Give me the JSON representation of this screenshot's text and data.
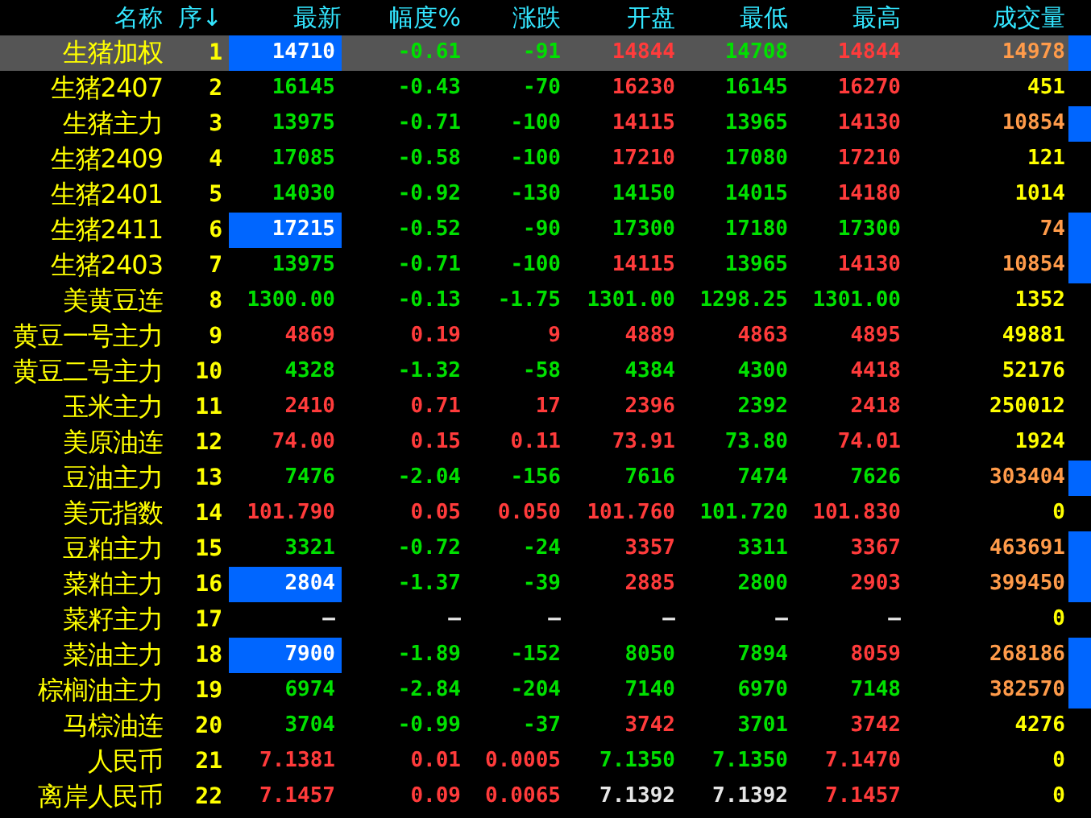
{
  "header": {
    "columns": [
      "名称",
      "序",
      "最新",
      "幅度%",
      "涨跌",
      "开盘",
      "最低",
      "最高",
      "成交量"
    ],
    "sort_arrow": "↓"
  },
  "rows": [
    {
      "name": "生猪加权",
      "index": "1",
      "selected": true,
      "latest_highlighted": true,
      "volume_marked": true,
      "cells": [
        {
          "text": "14710"
        },
        {
          "text": "-0.61",
          "kind": "fall"
        },
        {
          "text": "-91",
          "kind": "fall"
        },
        {
          "text": "14844",
          "kind": "rise"
        },
        {
          "text": "14708",
          "kind": "fall"
        },
        {
          "text": "14844",
          "kind": "rise"
        },
        {
          "text": "14978",
          "kind": "active"
        }
      ]
    },
    {
      "name": "生猪2407",
      "index": "2",
      "selected": false,
      "latest_highlighted": false,
      "volume_marked": false,
      "cells": [
        {
          "text": "16145",
          "kind": "fall"
        },
        {
          "text": "-0.43",
          "kind": "fall"
        },
        {
          "text": "-70",
          "kind": "fall"
        },
        {
          "text": "16230",
          "kind": "rise"
        },
        {
          "text": "16145",
          "kind": "fall"
        },
        {
          "text": "16270",
          "kind": "rise"
        },
        {
          "text": "451",
          "kind": "plain"
        }
      ]
    },
    {
      "name": "生猪主力",
      "index": "3",
      "selected": false,
      "latest_highlighted": false,
      "volume_marked": true,
      "cells": [
        {
          "text": "13975",
          "kind": "fall"
        },
        {
          "text": "-0.71",
          "kind": "fall"
        },
        {
          "text": "-100",
          "kind": "fall"
        },
        {
          "text": "14115",
          "kind": "rise"
        },
        {
          "text": "13965",
          "kind": "fall"
        },
        {
          "text": "14130",
          "kind": "rise"
        },
        {
          "text": "10854",
          "kind": "active"
        }
      ]
    },
    {
      "name": "生猪2409",
      "index": "4",
      "selected": false,
      "latest_highlighted": false,
      "volume_marked": false,
      "cells": [
        {
          "text": "17085",
          "kind": "fall"
        },
        {
          "text": "-0.58",
          "kind": "fall"
        },
        {
          "text": "-100",
          "kind": "fall"
        },
        {
          "text": "17210",
          "kind": "rise"
        },
        {
          "text": "17080",
          "kind": "fall"
        },
        {
          "text": "17210",
          "kind": "rise"
        },
        {
          "text": "121",
          "kind": "plain"
        }
      ]
    },
    {
      "name": "生猪2401",
      "index": "5",
      "selected": false,
      "latest_highlighted": false,
      "volume_marked": false,
      "cells": [
        {
          "text": "14030",
          "kind": "fall"
        },
        {
          "text": "-0.92",
          "kind": "fall"
        },
        {
          "text": "-130",
          "kind": "fall"
        },
        {
          "text": "14150",
          "kind": "fall"
        },
        {
          "text": "14015",
          "kind": "fall"
        },
        {
          "text": "14180",
          "kind": "rise"
        },
        {
          "text": "1014",
          "kind": "plain"
        }
      ]
    },
    {
      "name": "生猪2411",
      "index": "6",
      "selected": false,
      "latest_highlighted": true,
      "volume_marked": true,
      "cells": [
        {
          "text": "17215"
        },
        {
          "text": "-0.52",
          "kind": "fall"
        },
        {
          "text": "-90",
          "kind": "fall"
        },
        {
          "text": "17300",
          "kind": "fall"
        },
        {
          "text": "17180",
          "kind": "fall"
        },
        {
          "text": "17300",
          "kind": "fall"
        },
        {
          "text": "74",
          "kind": "active"
        }
      ]
    },
    {
      "name": "生猪2403",
      "index": "7",
      "selected": false,
      "latest_highlighted": false,
      "volume_marked": true,
      "cells": [
        {
          "text": "13975",
          "kind": "fall"
        },
        {
          "text": "-0.71",
          "kind": "fall"
        },
        {
          "text": "-100",
          "kind": "fall"
        },
        {
          "text": "14115",
          "kind": "rise"
        },
        {
          "text": "13965",
          "kind": "fall"
        },
        {
          "text": "14130",
          "kind": "rise"
        },
        {
          "text": "10854",
          "kind": "active"
        }
      ]
    },
    {
      "name": "美黄豆连",
      "index": "8",
      "selected": false,
      "latest_highlighted": false,
      "volume_marked": false,
      "cells": [
        {
          "text": "1300.00",
          "kind": "fall"
        },
        {
          "text": "-0.13",
          "kind": "fall"
        },
        {
          "text": "-1.75",
          "kind": "fall"
        },
        {
          "text": "1301.00",
          "kind": "fall"
        },
        {
          "text": "1298.25",
          "kind": "fall"
        },
        {
          "text": "1301.00",
          "kind": "fall"
        },
        {
          "text": "1352",
          "kind": "plain"
        }
      ]
    },
    {
      "name": "黄豆一号主力",
      "index": "9",
      "selected": false,
      "latest_highlighted": false,
      "volume_marked": false,
      "cells": [
        {
          "text": "4869",
          "kind": "rise"
        },
        {
          "text": "0.19",
          "kind": "rise"
        },
        {
          "text": "9",
          "kind": "rise"
        },
        {
          "text": "4889",
          "kind": "rise"
        },
        {
          "text": "4863",
          "kind": "rise"
        },
        {
          "text": "4895",
          "kind": "rise"
        },
        {
          "text": "49881",
          "kind": "plain"
        }
      ]
    },
    {
      "name": "黄豆二号主力",
      "index": "10",
      "selected": false,
      "latest_highlighted": false,
      "volume_marked": false,
      "cells": [
        {
          "text": "4328",
          "kind": "fall"
        },
        {
          "text": "-1.32",
          "kind": "fall"
        },
        {
          "text": "-58",
          "kind": "fall"
        },
        {
          "text": "4384",
          "kind": "fall"
        },
        {
          "text": "4300",
          "kind": "fall"
        },
        {
          "text": "4418",
          "kind": "rise"
        },
        {
          "text": "52176",
          "kind": "plain"
        }
      ]
    },
    {
      "name": "玉米主力",
      "index": "11",
      "selected": false,
      "latest_highlighted": false,
      "volume_marked": false,
      "cells": [
        {
          "text": "2410",
          "kind": "rise"
        },
        {
          "text": "0.71",
          "kind": "rise"
        },
        {
          "text": "17",
          "kind": "rise"
        },
        {
          "text": "2396",
          "kind": "rise"
        },
        {
          "text": "2392",
          "kind": "fall"
        },
        {
          "text": "2418",
          "kind": "rise"
        },
        {
          "text": "250012",
          "kind": "plain"
        }
      ]
    },
    {
      "name": "美原油连",
      "index": "12",
      "selected": false,
      "latest_highlighted": false,
      "volume_marked": false,
      "cells": [
        {
          "text": "74.00",
          "kind": "rise"
        },
        {
          "text": "0.15",
          "kind": "rise"
        },
        {
          "text": "0.11",
          "kind": "rise"
        },
        {
          "text": "73.91",
          "kind": "rise"
        },
        {
          "text": "73.80",
          "kind": "fall"
        },
        {
          "text": "74.01",
          "kind": "rise"
        },
        {
          "text": "1924",
          "kind": "plain"
        }
      ]
    },
    {
      "name": "豆油主力",
      "index": "13",
      "selected": false,
      "latest_highlighted": false,
      "volume_marked": true,
      "cells": [
        {
          "text": "7476",
          "kind": "fall"
        },
        {
          "text": "-2.04",
          "kind": "fall"
        },
        {
          "text": "-156",
          "kind": "fall"
        },
        {
          "text": "7616",
          "kind": "fall"
        },
        {
          "text": "7474",
          "kind": "fall"
        },
        {
          "text": "7626",
          "kind": "fall"
        },
        {
          "text": "303404",
          "kind": "active"
        }
      ]
    },
    {
      "name": "美元指数",
      "index": "14",
      "selected": false,
      "latest_highlighted": false,
      "volume_marked": false,
      "cells": [
        {
          "text": "101.790",
          "kind": "rise"
        },
        {
          "text": "0.05",
          "kind": "rise"
        },
        {
          "text": "0.050",
          "kind": "rise"
        },
        {
          "text": "101.760",
          "kind": "rise"
        },
        {
          "text": "101.720",
          "kind": "fall"
        },
        {
          "text": "101.830",
          "kind": "rise"
        },
        {
          "text": "0",
          "kind": "plain"
        }
      ]
    },
    {
      "name": "豆粕主力",
      "index": "15",
      "selected": false,
      "latest_highlighted": false,
      "volume_marked": true,
      "cells": [
        {
          "text": "3321",
          "kind": "fall"
        },
        {
          "text": "-0.72",
          "kind": "fall"
        },
        {
          "text": "-24",
          "kind": "fall"
        },
        {
          "text": "3357",
          "kind": "rise"
        },
        {
          "text": "3311",
          "kind": "fall"
        },
        {
          "text": "3367",
          "kind": "rise"
        },
        {
          "text": "463691",
          "kind": "active"
        }
      ]
    },
    {
      "name": "菜粕主力",
      "index": "16",
      "selected": false,
      "latest_highlighted": true,
      "volume_marked": true,
      "cells": [
        {
          "text": "2804"
        },
        {
          "text": "-1.37",
          "kind": "fall"
        },
        {
          "text": "-39",
          "kind": "fall"
        },
        {
          "text": "2885",
          "kind": "rise"
        },
        {
          "text": "2800",
          "kind": "fall"
        },
        {
          "text": "2903",
          "kind": "rise"
        },
        {
          "text": "399450",
          "kind": "active"
        }
      ]
    },
    {
      "name": "菜籽主力",
      "index": "17",
      "selected": false,
      "latest_highlighted": false,
      "volume_marked": false,
      "cells": [
        {
          "text": "—",
          "kind": "flat"
        },
        {
          "text": "—",
          "kind": "flat"
        },
        {
          "text": "—",
          "kind": "flat"
        },
        {
          "text": "—",
          "kind": "flat"
        },
        {
          "text": "—",
          "kind": "flat"
        },
        {
          "text": "—",
          "kind": "flat"
        },
        {
          "text": "0",
          "kind": "plain"
        }
      ]
    },
    {
      "name": "菜油主力",
      "index": "18",
      "selected": false,
      "latest_highlighted": true,
      "volume_marked": true,
      "cells": [
        {
          "text": "7900"
        },
        {
          "text": "-1.89",
          "kind": "fall"
        },
        {
          "text": "-152",
          "kind": "fall"
        },
        {
          "text": "8050",
          "kind": "fall"
        },
        {
          "text": "7894",
          "kind": "fall"
        },
        {
          "text": "8059",
          "kind": "rise"
        },
        {
          "text": "268186",
          "kind": "active"
        }
      ]
    },
    {
      "name": "棕榈油主力",
      "index": "19",
      "selected": false,
      "latest_highlighted": false,
      "volume_marked": true,
      "cells": [
        {
          "text": "6974",
          "kind": "fall"
        },
        {
          "text": "-2.84",
          "kind": "fall"
        },
        {
          "text": "-204",
          "kind": "fall"
        },
        {
          "text": "7140",
          "kind": "fall"
        },
        {
          "text": "6970",
          "kind": "fall"
        },
        {
          "text": "7148",
          "kind": "fall"
        },
        {
          "text": "382570",
          "kind": "active"
        }
      ]
    },
    {
      "name": "马棕油连",
      "index": "20",
      "selected": false,
      "latest_highlighted": false,
      "volume_marked": false,
      "cells": [
        {
          "text": "3704",
          "kind": "fall"
        },
        {
          "text": "-0.99",
          "kind": "fall"
        },
        {
          "text": "-37",
          "kind": "fall"
        },
        {
          "text": "3742",
          "kind": "rise"
        },
        {
          "text": "3701",
          "kind": "fall"
        },
        {
          "text": "3742",
          "kind": "rise"
        },
        {
          "text": "4276",
          "kind": "plain"
        }
      ]
    },
    {
      "name": "人民币",
      "index": "21",
      "selected": false,
      "latest_highlighted": false,
      "volume_marked": false,
      "cells": [
        {
          "text": "7.1381",
          "kind": "rise"
        },
        {
          "text": "0.01",
          "kind": "rise"
        },
        {
          "text": "0.0005",
          "kind": "rise"
        },
        {
          "text": "7.1350",
          "kind": "fall"
        },
        {
          "text": "7.1350",
          "kind": "fall"
        },
        {
          "text": "7.1470",
          "kind": "rise"
        },
        {
          "text": "0",
          "kind": "plain"
        }
      ]
    },
    {
      "name": "离岸人民币",
      "index": "22",
      "selected": false,
      "latest_highlighted": false,
      "volume_marked": false,
      "cells": [
        {
          "text": "7.1457",
          "kind": "rise"
        },
        {
          "text": "0.09",
          "kind": "rise"
        },
        {
          "text": "0.0065",
          "kind": "rise"
        },
        {
          "text": "7.1392",
          "kind": "flat"
        },
        {
          "text": "7.1392",
          "kind": "flat"
        },
        {
          "text": "7.1457",
          "kind": "rise"
        },
        {
          "text": "0",
          "kind": "plain"
        }
      ]
    }
  ]
}
